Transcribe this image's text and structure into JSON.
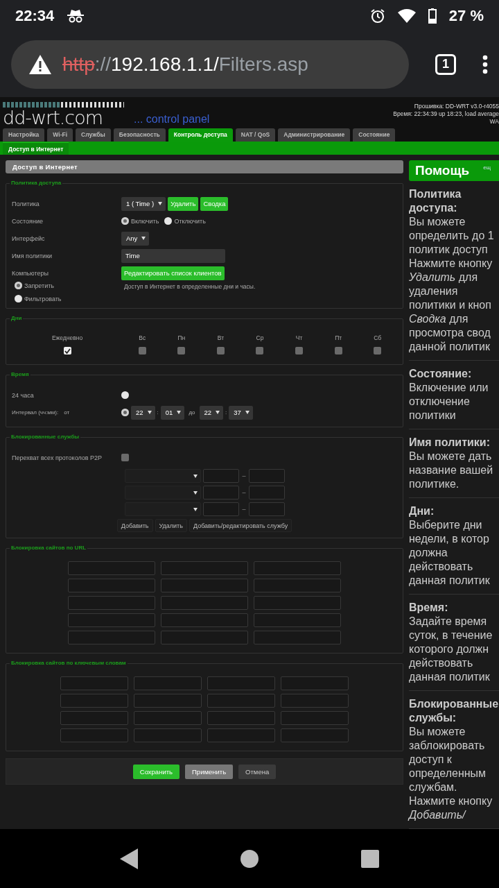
{
  "status_bar": {
    "time": "22:34",
    "battery": "27 %"
  },
  "browser": {
    "scheme": "http",
    "rest": "://192.168.1.1/Filters.asp",
    "tab_count": "1"
  },
  "header": {
    "logo": "dd-wrt.com",
    "tagline": "... control panel",
    "info": [
      "Прошивка: DD-WRT v3.0-r4055",
      "Время: 22:34:39 up 18:23, load average",
      "WA"
    ]
  },
  "tabs": [
    {
      "label": "Настройка",
      "selected": false
    },
    {
      "label": "Wi-Fi",
      "selected": false
    },
    {
      "label": "Службы",
      "selected": false
    },
    {
      "label": "Безопасность",
      "selected": false
    },
    {
      "label": "Контроль доступа",
      "selected": true
    },
    {
      "label": "NAT / QoS",
      "selected": false
    },
    {
      "label": "Администрирование",
      "selected": false
    },
    {
      "label": "Состояние",
      "selected": false
    }
  ],
  "subtabs": [
    {
      "label": "Доступ в Интернет",
      "selected": true
    }
  ],
  "title": "Доступ в Интернет",
  "policy_section": {
    "legend": "Политика доступа",
    "policy": {
      "label": "Политика",
      "value": "1 ( Time )",
      "buttons": [
        "Удалить",
        "Сводка"
      ]
    },
    "state": {
      "label": "Состояние",
      "options": [
        {
          "label": "Включить",
          "selected": true
        },
        {
          "label": "Отключить",
          "selected": false
        }
      ]
    },
    "interface": {
      "label": "Интерфейс",
      "value": "Any"
    },
    "name": {
      "label": "Имя политики",
      "value": "Time"
    },
    "computers": {
      "label": "Компьютеры",
      "button": "Редактировать список клиентов"
    },
    "mode": [
      {
        "label": "Запретить",
        "selected": true
      },
      {
        "label": "Фильтровать",
        "selected": false
      }
    ],
    "note": "Доступ в Интернет в определенные дни и часы."
  },
  "days_section": {
    "legend": "Дни",
    "days": [
      {
        "label": "Ежедневно",
        "checked": true
      },
      {
        "label": "Вс",
        "checked": false
      },
      {
        "label": "Пн",
        "checked": false
      },
      {
        "label": "Вт",
        "checked": false
      },
      {
        "label": "Ср",
        "checked": false
      },
      {
        "label": "Чт",
        "checked": false
      },
      {
        "label": "Пт",
        "checked": false
      },
      {
        "label": "Сб",
        "checked": false
      }
    ]
  },
  "time_section": {
    "legend": "Время",
    "all_day": {
      "label": "24 часа",
      "selected": false
    },
    "interval": {
      "label": "Интервал (чч:мм):",
      "from": "от",
      "selected": true,
      "from_h": "22",
      "from_m": "01",
      "to": "до",
      "to_h": "22",
      "to_m": "37",
      "sep": ":"
    }
  },
  "services_section": {
    "legend": "Блокированные службы",
    "p2p": {
      "label": "Перехват всех протоколов P2P",
      "checked": false
    },
    "rows": [
      {
        "dash": "–"
      },
      {
        "dash": "–"
      },
      {
        "dash": "–"
      }
    ],
    "buttons": [
      "Добавить",
      "Удалить",
      "Добавить/редактировать службу"
    ]
  },
  "url_section": {
    "legend": "Блокировка сайтов по URL"
  },
  "keyword_section": {
    "legend": "Блокировка сайтов по ключевым словам"
  },
  "footer_buttons": [
    {
      "label": "Сохранить",
      "kind": "primary"
    },
    {
      "label": "Применить",
      "kind": "secondary"
    },
    {
      "label": "Отмена",
      "kind": "cancel"
    }
  ],
  "help": {
    "title": "Помощь",
    "more": "ещ",
    "sections": [
      {
        "title": "Политика доступа:",
        "lines": [
          "Вы можете",
          "определить до 1",
          "политик доступ",
          "Нажмите кнопку",
          "*Удалить* для",
          "удаления",
          "политики и кноп",
          "*Сводка* для",
          "просмотра свод",
          "данной политик"
        ]
      },
      {
        "title": "Состояние:",
        "lines": [
          "Включение или",
          "отключение",
          "политики"
        ]
      },
      {
        "title": "Имя политики:",
        "lines": [
          "Вы можете дать",
          "название вашей",
          "политике."
        ]
      },
      {
        "title": "Дни:",
        "lines": [
          "Выберите дни",
          "недели, в котор",
          "должна",
          "действовать",
          "данная политик"
        ]
      },
      {
        "title": "Время:",
        "lines": [
          "Задайте время",
          "суток, в течение",
          "которого должн",
          "действовать",
          "данная политик"
        ]
      },
      {
        "title": "Блокированные службы:",
        "lines": [
          "Вы можете",
          "заблокировать",
          "доступ к",
          "определенным",
          "службам.",
          "Нажмите кнопку",
          "*Добавить/*"
        ]
      }
    ]
  }
}
